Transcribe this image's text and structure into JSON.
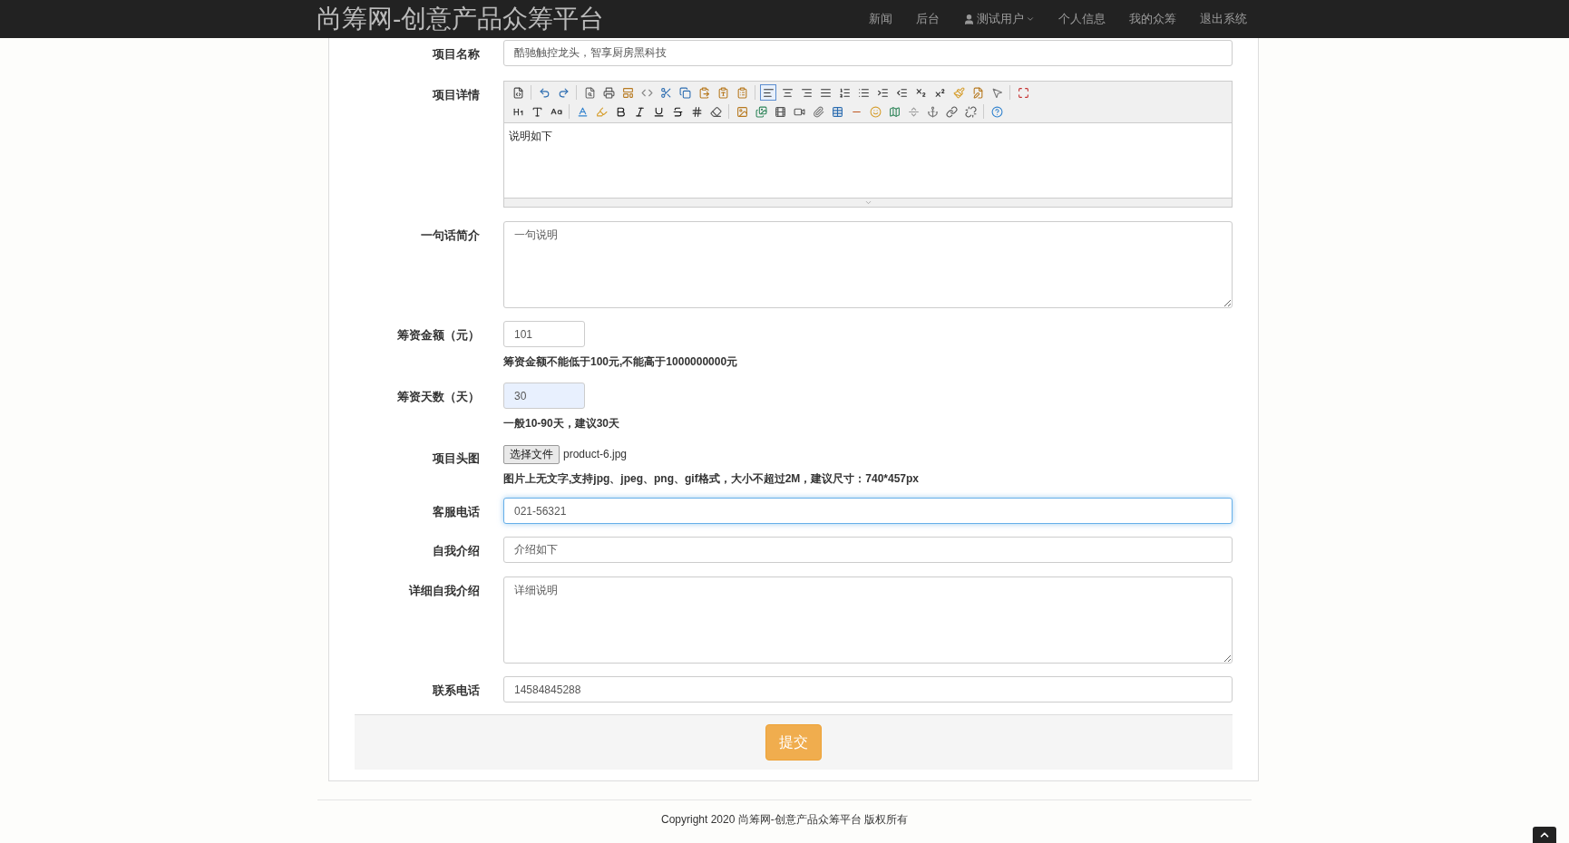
{
  "navbar": {
    "brand": "尚筹网-创意产品众筹平台",
    "links": [
      {
        "label": "新闻",
        "kind": "link"
      },
      {
        "label": "后台",
        "kind": "link"
      },
      {
        "label": "测试用户",
        "kind": "user-dropdown"
      },
      {
        "label": "个人信息",
        "kind": "link"
      },
      {
        "label": "我的众筹",
        "kind": "link"
      },
      {
        "label": "退出系统",
        "kind": "link"
      }
    ]
  },
  "form": {
    "rows": [
      {
        "label": "项目名称",
        "kind": "input",
        "value": "酷驰触控龙头，智享厨房黑科技",
        "focused": false,
        "autofilled": false
      },
      {
        "label": "项目详情",
        "kind": "editor",
        "value": "说明如下",
        "toolbar": [
          [
            {
              "kind": "source",
              "selected": false
            },
            {
              "kind": "sep"
            },
            {
              "kind": "undo",
              "selected": false
            },
            {
              "kind": "redo",
              "selected": false
            },
            {
              "kind": "sep"
            },
            {
              "kind": "preview",
              "selected": false
            },
            {
              "kind": "print",
              "selected": false
            },
            {
              "kind": "template",
              "selected": false
            },
            {
              "kind": "code",
              "selected": false
            },
            {
              "kind": "cut",
              "selected": false
            },
            {
              "kind": "copy",
              "selected": false
            },
            {
              "kind": "paste",
              "selected": false
            },
            {
              "kind": "paste-text",
              "selected": false
            },
            {
              "kind": "paste-word",
              "selected": false
            },
            {
              "kind": "sep"
            },
            {
              "kind": "align-left",
              "selected": true
            },
            {
              "kind": "align-center",
              "selected": false
            },
            {
              "kind": "align-right",
              "selected": false
            },
            {
              "kind": "justify",
              "selected": false
            },
            {
              "kind": "ordered-list",
              "selected": false
            },
            {
              "kind": "bullet-list",
              "selected": false
            },
            {
              "kind": "indent",
              "selected": false
            },
            {
              "kind": "outdent",
              "selected": false
            },
            {
              "kind": "subscript",
              "selected": false
            },
            {
              "kind": "superscript",
              "selected": false
            },
            {
              "kind": "clear-format",
              "selected": false
            },
            {
              "kind": "select-all",
              "selected": false
            },
            {
              "kind": "pointer",
              "selected": false
            },
            {
              "kind": "sep"
            },
            {
              "kind": "fullscreen",
              "selected": false
            }
          ],
          [
            {
              "kind": "heading",
              "selected": false
            },
            {
              "kind": "font",
              "selected": false
            },
            {
              "kind": "font-size",
              "selected": false
            },
            {
              "kind": "sep"
            },
            {
              "kind": "font-color",
              "selected": false
            },
            {
              "kind": "highlight",
              "selected": false
            },
            {
              "kind": "bold",
              "selected": false
            },
            {
              "kind": "italic",
              "selected": false
            },
            {
              "kind": "underline",
              "selected": false
            },
            {
              "kind": "strike",
              "selected": false
            },
            {
              "kind": "line-height",
              "selected": false
            },
            {
              "kind": "eraser",
              "selected": false
            },
            {
              "kind": "sep"
            },
            {
              "kind": "image",
              "selected": false
            },
            {
              "kind": "multi-image",
              "selected": false
            },
            {
              "kind": "flash",
              "selected": false
            },
            {
              "kind": "media",
              "selected": false
            },
            {
              "kind": "attachment",
              "selected": false
            },
            {
              "kind": "table",
              "selected": false
            },
            {
              "kind": "hr",
              "selected": false
            },
            {
              "kind": "emoticon",
              "selected": false
            },
            {
              "kind": "map",
              "selected": false
            },
            {
              "kind": "pagebreak",
              "selected": false
            },
            {
              "kind": "anchor",
              "selected": false
            },
            {
              "kind": "link",
              "selected": false
            },
            {
              "kind": "unlink",
              "selected": false
            },
            {
              "kind": "sep"
            },
            {
              "kind": "help",
              "selected": false
            }
          ]
        ]
      },
      {
        "label": "一句话简介",
        "kind": "textarea",
        "value": "一句说明"
      },
      {
        "label": "筹资金额（元）",
        "kind": "short-input",
        "value": "101",
        "focused": false,
        "autofilled": false,
        "help": "筹资金额不能低于100元,不能高于1000000000元"
      },
      {
        "label": "筹资天数（天）",
        "kind": "short-input",
        "value": "30",
        "focused": false,
        "autofilled": true,
        "help": "一般10-90天，建议30天"
      },
      {
        "label": "项目头图",
        "kind": "file",
        "button": "选择文件",
        "value": "product-6.jpg",
        "help": "图片上无文字,支持jpg、jpeg、png、gif格式，大小不超过2M，建议尺寸：740*457px"
      },
      {
        "label": "客服电话",
        "kind": "input",
        "value": "021-56321",
        "focused": true,
        "autofilled": false
      },
      {
        "label": "自我介绍",
        "kind": "input",
        "value": "介绍如下",
        "focused": false,
        "autofilled": false
      },
      {
        "label": "详细自我介绍",
        "kind": "textarea",
        "value": "详细说明"
      },
      {
        "label": "联系电话",
        "kind": "input",
        "value": "14584845288",
        "focused": false,
        "autofilled": false
      }
    ],
    "submit": "提交"
  },
  "footer": {
    "copyright": "Copyright 2020 尚筹网-创意产品众筹平台 版权所有"
  }
}
